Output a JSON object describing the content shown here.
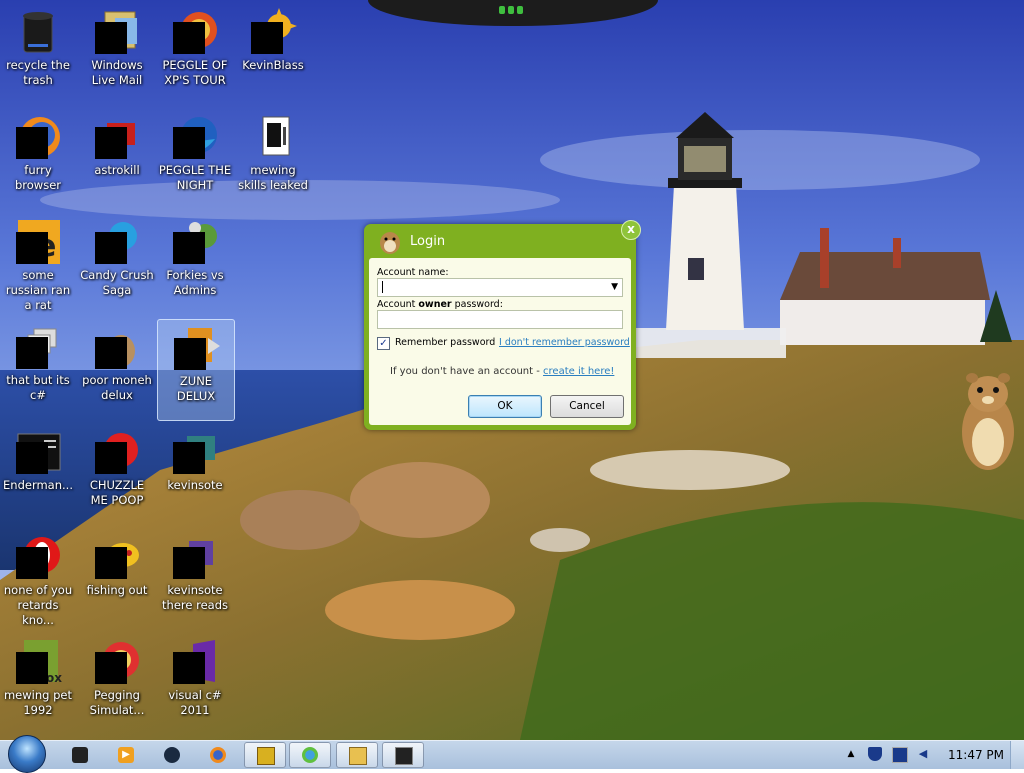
{
  "desktop": {
    "icons": [
      {
        "label": "recycle the trash",
        "icon": "recycle-bin-icon"
      },
      {
        "label": "Windows Live Mail",
        "icon": "mail-app-icon"
      },
      {
        "label": "PEGGLE OF XP'S TOUR",
        "icon": "peggle-icon"
      },
      {
        "label": "KevinBlass",
        "icon": "sun-icon"
      },
      {
        "label": "furry browser",
        "icon": "firefox-icon"
      },
      {
        "label": "astrokill",
        "icon": "game-icon"
      },
      {
        "label": "PEGGLE THE NIGHT",
        "icon": "peggle-night-icon"
      },
      {
        "label": "mewing skills leaked",
        "icon": "document-icon"
      },
      {
        "label": "some russian ran a rat",
        "icon": "rat-app-icon"
      },
      {
        "label": "Candy Crush Saga",
        "icon": "candy-icon"
      },
      {
        "label": "Forkies vs Admins",
        "icon": "plants-game-icon"
      },
      {
        "label": "that but its c#",
        "icon": "windows-stack-icon"
      },
      {
        "label": "poor moneh delux",
        "icon": "money-bag-icon"
      },
      {
        "label": "ZUNE DELUX",
        "icon": "zune-icon"
      },
      {
        "label": "Enderman...",
        "icon": "terminal-icon"
      },
      {
        "label": "CHUZZLE ME POOP",
        "icon": "chuzzle-icon"
      },
      {
        "label": "kevinsote",
        "icon": "app-icon"
      },
      {
        "label": "none of you retards kno...",
        "icon": "opera-icon"
      },
      {
        "label": "fishing out",
        "icon": "fish-icon"
      },
      {
        "label": "kevinsote there reads",
        "icon": "app-icon"
      },
      {
        "label": "mewing pet 1992",
        "icon": "pet-game-icon"
      },
      {
        "label": "Pegging Simulat...",
        "icon": "peggle-icon"
      },
      {
        "label": "visual c# 2011",
        "icon": "visual-studio-icon"
      }
    ]
  },
  "login": {
    "title": "Login",
    "account_name_label": "Account name:",
    "account_name_value": "",
    "password_label_prefix": "Account ",
    "password_label_bold": "owner",
    "password_label_suffix": " password:",
    "remember_label": "Remember password",
    "remember_checked": true,
    "forgot_link": "I don't remember password",
    "create_prefix": "If you don't have an account - ",
    "create_link": "create it here!",
    "ok_label": "OK",
    "cancel_label": "Cancel",
    "close_glyph": "x",
    "accent_color": "#7fb020"
  },
  "taskbar": {
    "pinned": [
      "app-icon",
      "media-player-icon",
      "steam-icon",
      "firefox-icon",
      "peggle-icon",
      "messenger-icon",
      "explorer-icon",
      "cmd-icon"
    ],
    "clock": "11:47 PM",
    "tray": [
      "show-hidden-icons-icon",
      "security-shield-icon",
      "network-icon",
      "volume-icon"
    ]
  }
}
